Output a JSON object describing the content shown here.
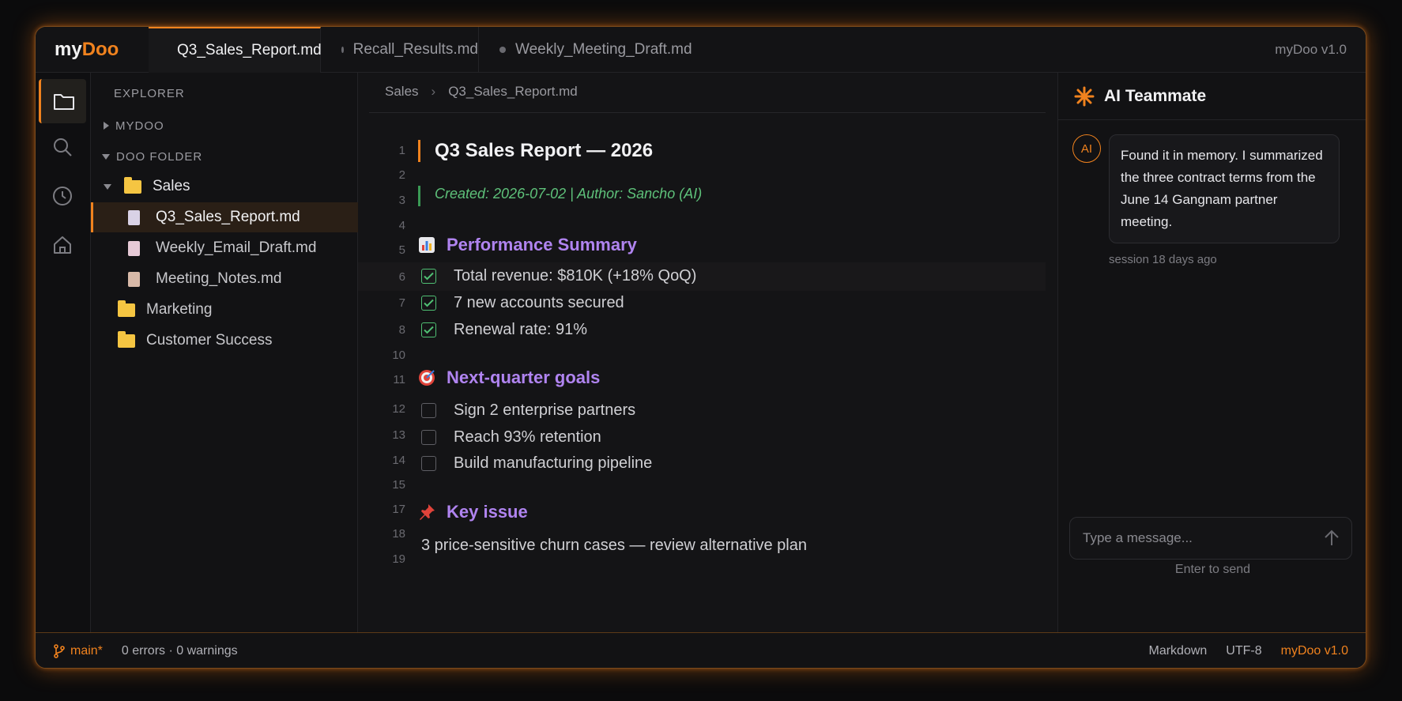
{
  "app": {
    "logo_main": "my",
    "logo_accent": "Doo",
    "version_top": "myDoo v1.0"
  },
  "tabs": [
    {
      "label": "Q3_Sales_Report.md",
      "active": true
    },
    {
      "label": "Recall_Results.md",
      "active": false
    },
    {
      "label": "Weekly_Meeting_Draft.md",
      "active": false
    }
  ],
  "activity": [
    "folder-icon",
    "search-icon",
    "clock-icon",
    "home-icon"
  ],
  "explorer": {
    "title": "EXPLORER",
    "section_mydoo": "MYDOO",
    "section_folder": "DOO FOLDER",
    "sales_folder": "Sales",
    "files": [
      "Q3_Sales_Report.md",
      "Weekly_Email_Draft.md",
      "Meeting_Notes.md"
    ],
    "folders": [
      "Marketing",
      "Customer Success"
    ]
  },
  "breadcrumb": {
    "parent": "Sales",
    "current": "Q3_Sales_Report.md"
  },
  "editor": {
    "line_numbers": [
      "1",
      "2",
      "3",
      "4",
      "5",
      "6",
      "7",
      "8",
      "10",
      "11",
      "12",
      "13",
      "14",
      "15",
      "17",
      "18",
      "19"
    ],
    "title": "Q3 Sales Report — 2026",
    "meta": "Created: 2026-07-02 | Author: Sancho (AI)",
    "h_performance": "Performance Summary",
    "performance_items": [
      "Total revenue: $810K (+18% QoQ)",
      "7 new accounts secured",
      "Renewal rate: 91%"
    ],
    "h_goals": "Next-quarter goals",
    "goal_items": [
      "Sign 2 enterprise partners",
      "Reach 93% retention",
      "Build manufacturing pipeline"
    ],
    "h_issue": "Key issue",
    "issue_text": "3 price-sensitive churn cases — review alternative plan"
  },
  "ai": {
    "title": "AI Teammate",
    "avatar": "AI",
    "message": "Found it in memory. I summarized the three contract terms from the June 14 Gangnam partner meeting.",
    "session": "session 18 days ago",
    "input_placeholder": "Type a message...",
    "hint": "Enter to send"
  },
  "status": {
    "branch": "main*",
    "problems": "0 errors · 0 warnings",
    "language": "Markdown",
    "encoding": "UTF-8",
    "version": "myDoo v1.0"
  },
  "colors": {
    "accent": "#f0821e",
    "heading": "#b084f0",
    "meta_green": "#5ec17a",
    "check_green": "#4fbf73"
  }
}
